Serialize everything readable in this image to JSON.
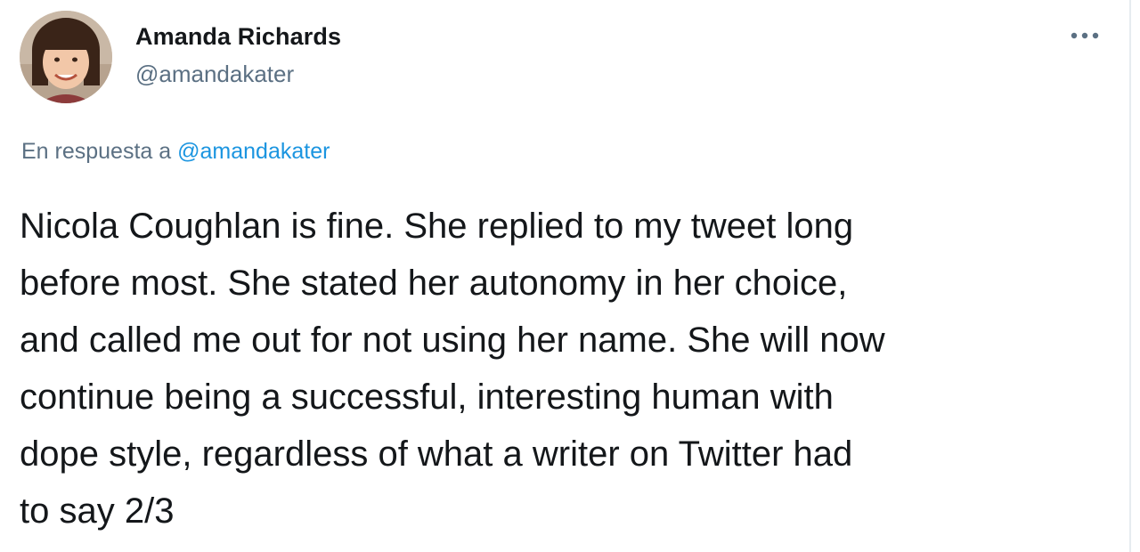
{
  "author": {
    "name": "Amanda Richards",
    "handle": "@amandakater",
    "avatar": "avatar-photo"
  },
  "more_icon": "ellipsis-icon",
  "reply": {
    "prefix": "En respuesta a",
    "mention": "@amandakater"
  },
  "tweet": {
    "text": "Nicola Coughlan is fine. She replied to my tweet long\nbefore most. She stated her autonomy in her choice,\nand called me out for not using her name. She will now\ncontinue being a successful, interesting human with\ndope style, regardless of what a writer on Twitter had\nto say 2/3"
  },
  "colors": {
    "text_primary": "#14171a",
    "text_secondary": "#5b7083",
    "link": "#1b95e0",
    "background": "#ffffff"
  }
}
